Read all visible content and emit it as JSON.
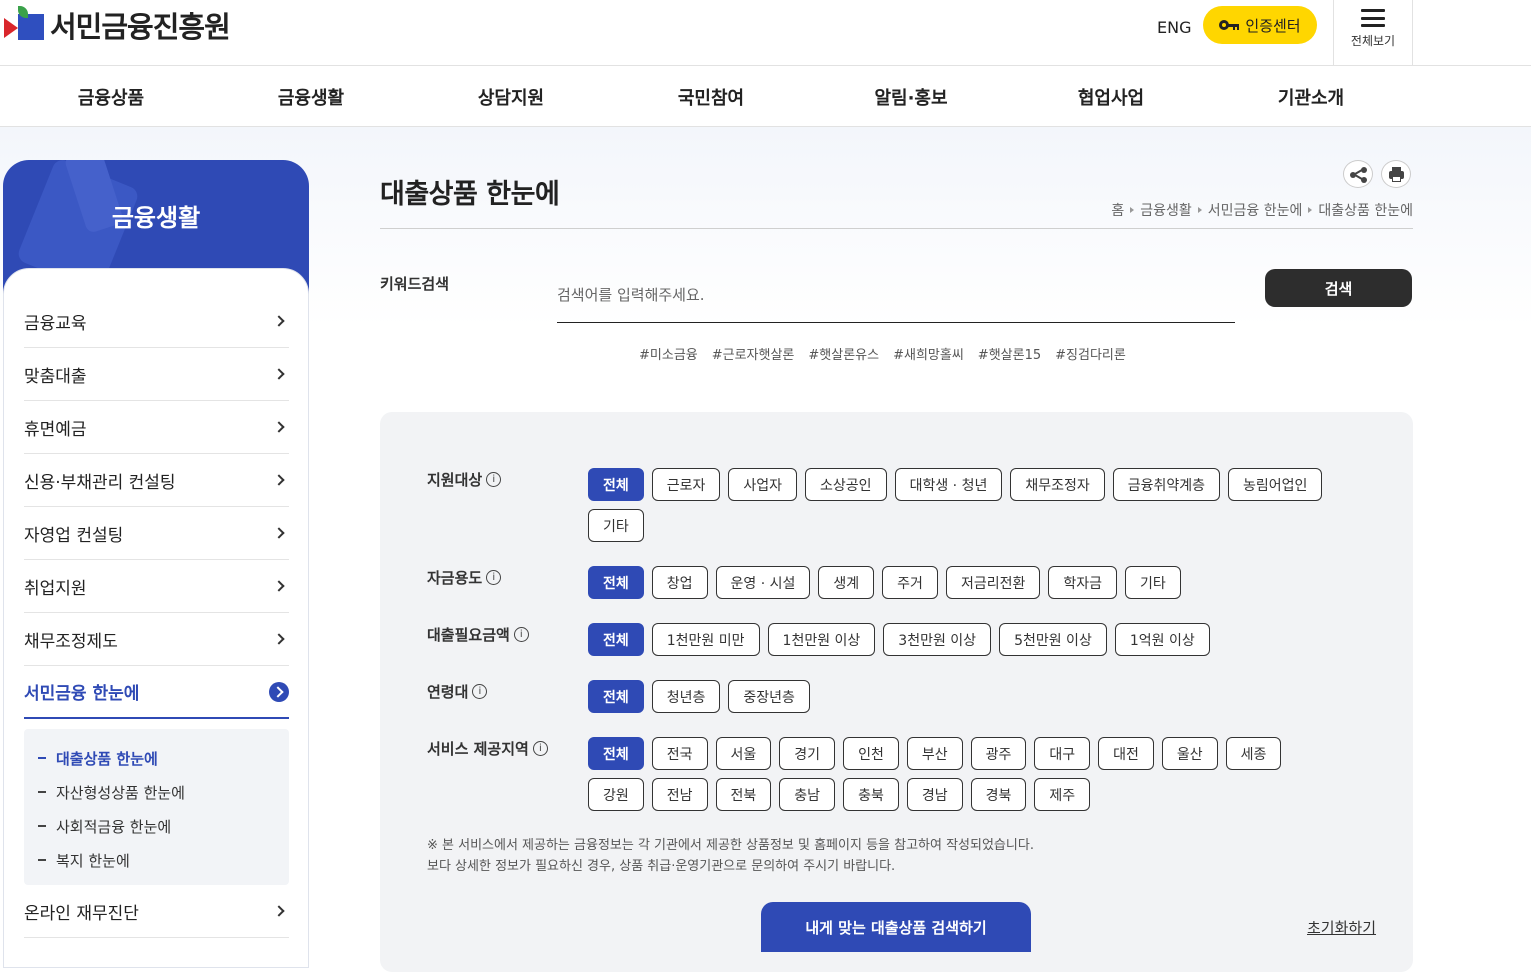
{
  "header": {
    "logo_text": "서민금융진흥원",
    "eng": "ENG",
    "cert_button": "인증센터",
    "all_menu": "전체보기"
  },
  "gnb": [
    "금융상품",
    "금융생활",
    "상담지원",
    "국민참여",
    "알림·홍보",
    "협업사업",
    "기관소개"
  ],
  "sidebar": {
    "title": "금융생활",
    "items": [
      "금융교육",
      "맞춤대출",
      "휴면예금",
      "신용·부채관리 컨설팅",
      "자영업 컨설팅",
      "취업지원",
      "채무조정제도"
    ],
    "active_item": "서민금융 한눈에",
    "sub_items": [
      "대출상품 한눈에",
      "자산형성상품 한눈에",
      "사회적금융 한눈에",
      "복지 한눈에"
    ],
    "after_item": "온라인 재무진단"
  },
  "page": {
    "title": "대출상품 한눈에",
    "breadcrumb": [
      "홈",
      "금융생활",
      "서민금융 한눈에",
      "대출상품 한눈에"
    ]
  },
  "keyword": {
    "label": "키워드검색",
    "placeholder": "검색어를 입력해주세요.",
    "button": "검색",
    "hashtags": [
      "#미소금융",
      "#근로자햇살론",
      "#햇살론유스",
      "#새희망홀씨",
      "#햇살론15",
      "#징검다리론"
    ]
  },
  "filters": {
    "target": {
      "label": "지원대상",
      "options": [
        "전체",
        "근로자",
        "사업자",
        "소상공인",
        "대학생 · 청년",
        "채무조정자",
        "금융취약계층",
        "농림어업인",
        "기타"
      ]
    },
    "purpose": {
      "label": "자금용도",
      "options": [
        "전체",
        "창업",
        "운영 · 시설",
        "생계",
        "주거",
        "저금리전환",
        "학자금",
        "기타"
      ]
    },
    "amount": {
      "label": "대출필요금액",
      "options": [
        "전체",
        "1천만원 미만",
        "1천만원 이상",
        "3천만원 이상",
        "5천만원 이상",
        "1억원 이상"
      ]
    },
    "age": {
      "label": "연령대",
      "options": [
        "전체",
        "청년층",
        "중장년층"
      ]
    },
    "region": {
      "label": "서비스 제공지역",
      "options": [
        "전체",
        "전국",
        "서울",
        "경기",
        "인천",
        "부산",
        "광주",
        "대구",
        "대전",
        "울산",
        "세종",
        "강원",
        "전남",
        "전북",
        "충남",
        "충북",
        "경남",
        "경북",
        "제주"
      ]
    },
    "info_glyph": "i"
  },
  "notice": {
    "line1": "※ 본 서비스에서 제공하는 금융정보는 각 기관에서 제공한 상품정보 및 홈페이지 등을 참고하여 작성되었습니다.",
    "line2": "보다 상세한 정보가 필요하신 경우, 상품 취급·운영기관으로 문의하여 주시기 바랍니다."
  },
  "actions": {
    "search": "내게 맞는 대출상품 검색하기",
    "reset": "초기화하기"
  },
  "colors": {
    "primary": "#2f4ab5",
    "cert_yellow": "#ffd600",
    "dark_button": "#2d2d2d"
  }
}
